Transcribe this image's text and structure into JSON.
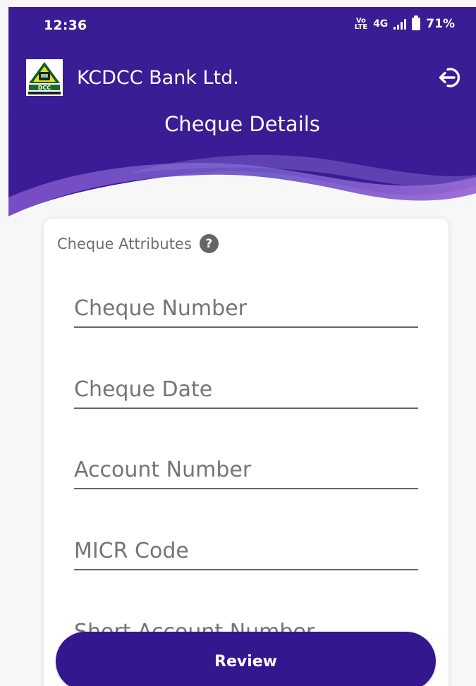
{
  "status_bar": {
    "time": "12:36",
    "volte_top": "Vo",
    "volte_bottom": "LTE",
    "network": "4G",
    "battery": "71%"
  },
  "app_bar": {
    "bank_name": "KCDCC Bank Ltd.",
    "page_title": "Cheque Details",
    "logo_icon": "bank-logo-icon",
    "logout_icon": "logout-icon"
  },
  "form": {
    "section_title": "Cheque Attributes",
    "help_icon": "help-icon",
    "fields": [
      {
        "placeholder": "Cheque Number",
        "value": ""
      },
      {
        "placeholder": "Cheque Date",
        "value": ""
      },
      {
        "placeholder": "Account Number",
        "value": ""
      },
      {
        "placeholder": "MICR Code",
        "value": ""
      },
      {
        "placeholder": "Short Account Number",
        "value": ""
      }
    ]
  },
  "actions": {
    "review_label": "Review"
  },
  "colors": {
    "header_primary": "#3a1b95",
    "header_accent": "#8c5fd0",
    "button_background": "#34178f",
    "card_background": "#ffffff",
    "input_line": "#666666"
  }
}
